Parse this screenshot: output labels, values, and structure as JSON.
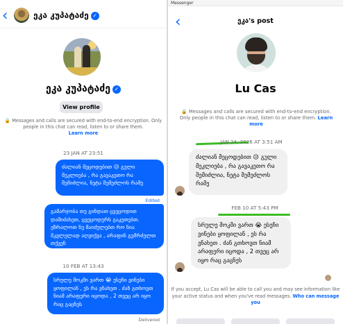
{
  "left": {
    "header": {
      "name": "ეკა კუპატაძე",
      "verified_mark": "✓"
    },
    "profile": {
      "name": "ეკა კუპატაძე",
      "view_profile_label": "View profile"
    },
    "encryption": {
      "text": "Messages and calls are secured with end-to-end encryption. Only people in this chat can read, listen to or share them.",
      "learn_more": "Learn more"
    },
    "timestamps": [
      "23 JAN AT 23:51",
      "10 FEB AT 13:43"
    ],
    "messages": [
      "ძალიან მეცოდებით 😥 გული მეკლიება , რა გავაკეთო რა შემიძლია, ნეტა შემეძლოს რამე",
      "გამარჯობა თუ გინდათ ცვეცოდით დამიძახეთ, ცვეცოდერს გაკეთებთ. ეზრალოთ ნუ მაიძულებთ რო ნია მკვლელად აღვიქვა , არაფინ გემრძელთ თქვენ",
      "სრულე შოკში ვართ 😭 ესეჩი ვინები ყოფილან , ეს რა ვნახეთ . ძან გთხოვთ ნიამ არაფერი იცოდა , 2 თვეც არ იყო რაც გაცნეს"
    ],
    "edited_label": "Edited",
    "delivered_label": "Delivered",
    "icons": [
      "back-arrow-icon",
      "verified-badge-icon",
      "lock-icon"
    ]
  },
  "right": {
    "app_title": "Messenger",
    "title": "ეკა's post",
    "profile_name": "Lu Cas",
    "encryption": {
      "text": "Messages and calls are secured with end-to-end encryption. Only people in this chat can read, listen to or share them.",
      "learn_more": "Learn more"
    },
    "timestamps": [
      "JAN 24, 2026 AT 3:51 AM",
      "FEB 10 AT 5:43 PM"
    ],
    "messages": [
      "ძალიან მეცოდებით 😥 გული მეკლიება , რა გავაკეთო რა შემიძლია, ნეტა შემეძლოს რამე",
      "სრულე შოკში ვართ 😭 ესეჩი ვინები ყოფილან , ეს რა ვნახეთ . ძან გთხოვთ ნიამ არაფერი იცოდა , 2 თვეც არ იყო რაც გაცნეს"
    ],
    "accept_notice": "If you accept, Lu Cas will be able to call you and may see information like your active status and when you've read messages.",
    "who_can_message": "Who can message you",
    "highlight_color": "#3dbb25",
    "icons": [
      "back-arrow-icon",
      "lock-icon"
    ]
  },
  "colors": {
    "accent": "#0866ff",
    "incoming_bubble": "#f0f0f0",
    "muted_text": "#65676b"
  }
}
